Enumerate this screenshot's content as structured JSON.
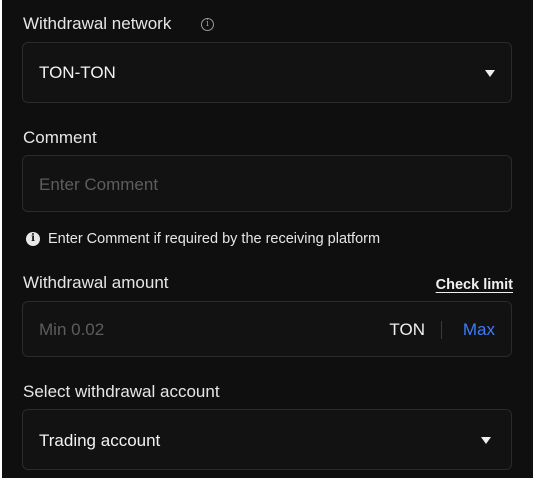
{
  "colors": {
    "background": "#0f0f0f",
    "field_border": "#2b2b2b",
    "placeholder": "#5d5d5d",
    "accent_max": "#3d7bfa"
  },
  "network": {
    "label": "Withdrawal network",
    "info_icon": "info-outline-icon",
    "selected": "TON-TON",
    "caret_icon": "caret-down-icon"
  },
  "comment": {
    "label": "Comment",
    "placeholder": "Enter Comment",
    "note_icon": "info-filled-icon",
    "note": "Enter Comment if required by the receiving platform"
  },
  "amount": {
    "label": "Withdrawal amount",
    "check_limit": "Check limit",
    "placeholder": "Min 0.02",
    "unit": "TON",
    "max": "Max"
  },
  "account": {
    "label": "Select withdrawal account",
    "selected": "Trading account",
    "caret_icon": "caret-down-icon"
  }
}
